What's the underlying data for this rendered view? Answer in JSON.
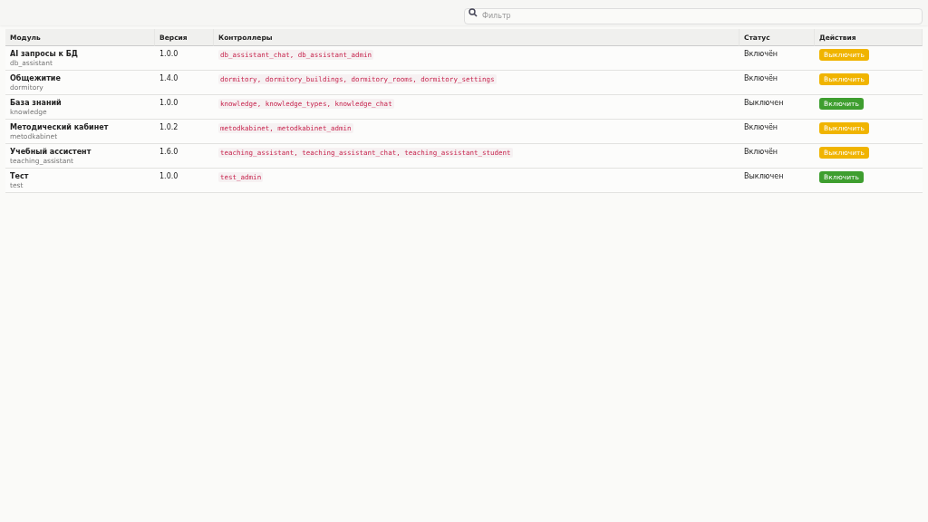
{
  "search": {
    "placeholder": "Фильтр"
  },
  "table": {
    "columns": [
      "Модуль",
      "Версия",
      "Контроллеры",
      "Статус",
      "Действия"
    ],
    "rows": [
      {
        "name": "AI запросы к БД",
        "id": "db_assistant",
        "version": "1.0.0",
        "controllers": "db_assistant_chat, db_assistant_admin",
        "status": "Включён",
        "enabled": true,
        "action": "Выключить"
      },
      {
        "name": "Общежитие",
        "id": "dormitory",
        "version": "1.4.0",
        "controllers": "dormitory, dormitory_buildings, dormitory_rooms, dormitory_settings",
        "status": "Включён",
        "enabled": true,
        "action": "Выключить"
      },
      {
        "name": "База знаний",
        "id": "knowledge",
        "version": "1.0.0",
        "controllers": "knowledge, knowledge_types, knowledge_chat",
        "status": "Выключен",
        "enabled": false,
        "action": "Включить"
      },
      {
        "name": "Методический кабинет",
        "id": "metodkabinet",
        "version": "1.0.2",
        "controllers": "metodkabinet, metodkabinet_admin",
        "status": "Включён",
        "enabled": true,
        "action": "Выключить"
      },
      {
        "name": "Учебный ассистент",
        "id": "teaching_assistant",
        "version": "1.6.0",
        "controllers": "teaching_assistant, teaching_assistant_chat, teaching_assistant_student",
        "status": "Включён",
        "enabled": true,
        "action": "Выключить"
      },
      {
        "name": "Тест",
        "id": "test",
        "version": "1.0.0",
        "controllers": "test_admin",
        "status": "Выключен",
        "enabled": false,
        "action": "Включить"
      }
    ]
  }
}
